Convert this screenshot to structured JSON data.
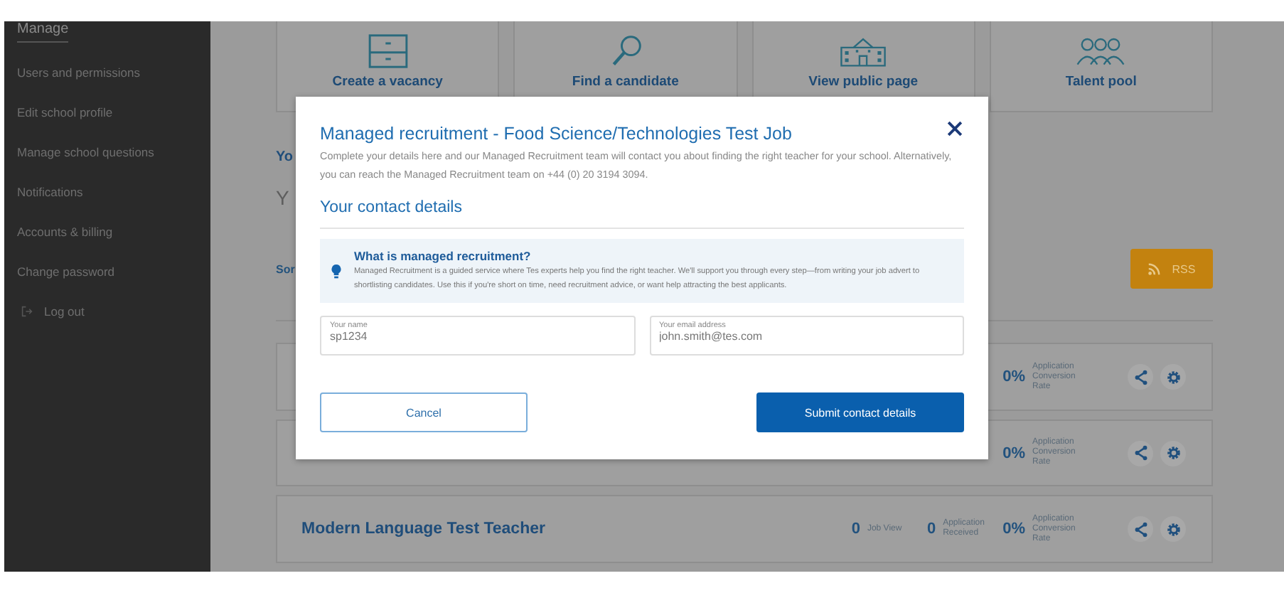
{
  "sidebar": {
    "heading": "Manage",
    "items": [
      "Users and permissions",
      "Edit school profile",
      "Manage school questions",
      "Notifications",
      "Accounts & billing",
      "Change password"
    ],
    "logout": "Log out"
  },
  "tiles": [
    {
      "label": "Create a vacancy"
    },
    {
      "label": "Find a candidate"
    },
    {
      "label": "View public page"
    },
    {
      "label": "Talent pool"
    }
  ],
  "page": {
    "heading": "Yo",
    "subheading": "Y",
    "sort_label": "Sor",
    "rss_button": "RSS"
  },
  "jobs": [
    {
      "stats": [
        {
          "kind": "percent",
          "value": "0%",
          "label": "Application Conversion Rate"
        }
      ]
    },
    {
      "stats": [
        {
          "kind": "percent",
          "value": "0%",
          "label": "Application Conversion Rate"
        }
      ]
    },
    {
      "title": "Modern Language Test Teacher",
      "stats": [
        {
          "kind": "count",
          "value": "0",
          "label": "Job View"
        },
        {
          "kind": "count",
          "value": "0",
          "label": "Application Received"
        },
        {
          "kind": "percent",
          "value": "0%",
          "label": "Application Conversion Rate"
        }
      ]
    }
  ],
  "modal": {
    "title": "Managed recruitment - Food Science/Technologies Test Job",
    "intro": "Complete your details here and our Managed Recruitment team will contact you about finding the right teacher for your school. Alternatively, you can reach the Managed Recruitment team on +44 (0) 20 3194 3094.",
    "section": "Your contact details",
    "info_title": "What is managed recruitment?",
    "info_body": "Managed Recruitment is a guided service where Tes experts help you find the right teacher. We'll support you through every step—from writing your job advert to shortlisting candidates. Use this if you're short on time, need recruitment advice, or want help attracting the best applicants.",
    "fields": [
      {
        "label": "Your name",
        "value": "sp1234"
      },
      {
        "label": "Your email address",
        "value": "john.smith@tes.com"
      }
    ],
    "cancel_button": "Cancel",
    "submit_button": "Submit contact details"
  }
}
